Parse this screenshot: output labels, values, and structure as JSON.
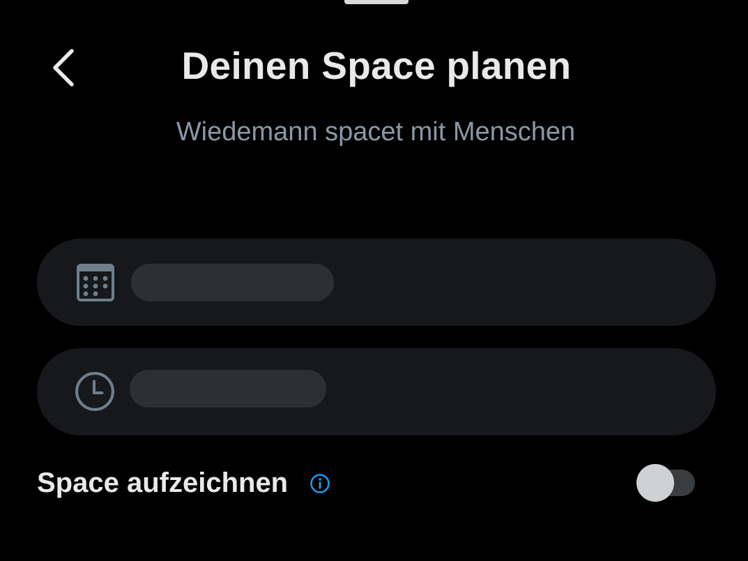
{
  "header": {
    "title": "Deinen Space planen",
    "subtitle": "Wiedemann spacet mit Menschen",
    "back_icon": "chevron-left-icon"
  },
  "schedule": {
    "date_field": {
      "icon": "calendar-icon",
      "value": ""
    },
    "time_field": {
      "icon": "clock-icon",
      "value": ""
    }
  },
  "record": {
    "label": "Space aufzeichnen",
    "info_icon": "info-icon",
    "toggle_on": false
  },
  "colors": {
    "background": "#000000",
    "field_background": "#16181c",
    "skeleton": "#2b3035",
    "text_primary": "#e7e9ea",
    "text_secondary": "#8b98a5",
    "accent": "#1d9bf0",
    "icon_muted": "#6e7f8b"
  }
}
